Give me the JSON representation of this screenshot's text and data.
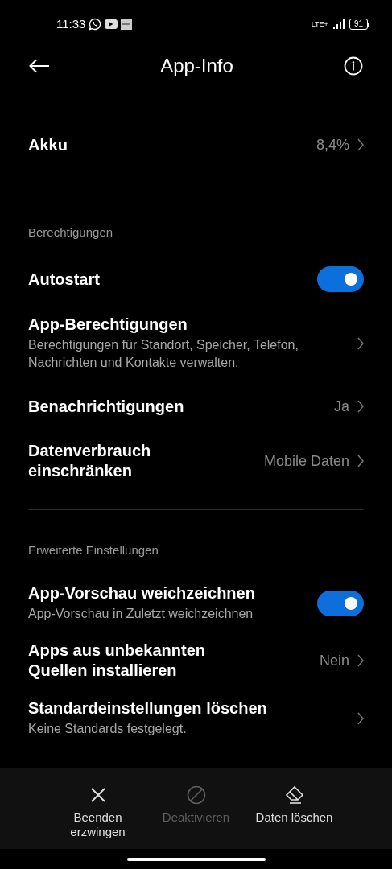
{
  "status_bar": {
    "time": "11:33",
    "network": "LTE+",
    "battery": "91"
  },
  "header": {
    "title": "App-Info"
  },
  "top_items": [
    {
      "kind": "value",
      "title": "Akku",
      "value": "8,4%"
    }
  ],
  "sections": [
    {
      "title": "Berechtigungen",
      "items": [
        {
          "kind": "toggle",
          "title": "Autostart",
          "on": true
        },
        {
          "kind": "value",
          "title": "App-Berechtigungen",
          "subtitle": "Berechtigungen für Standort, Speicher, Telefon, Nachrichten und Kontakte verwalten."
        },
        {
          "kind": "value",
          "title": "Benachrichtigungen",
          "value": "Ja"
        },
        {
          "kind": "value",
          "title": "Datenverbrauch einschränken",
          "value": "Mobile Daten"
        }
      ]
    },
    {
      "title": "Erweiterte Einstellungen",
      "items": [
        {
          "kind": "toggle",
          "title": "App-Vorschau weichzeichnen",
          "subtitle": "App-Vorschau in Zuletzt weichzeichnen",
          "on": true
        },
        {
          "kind": "value",
          "title": "Apps aus unbekannten Quellen installieren",
          "value": "Nein"
        },
        {
          "kind": "value",
          "title": "Standardeinstellungen löschen",
          "subtitle": "Keine Standards festgelegt."
        }
      ]
    }
  ],
  "actions": [
    {
      "kind": "stop",
      "label": "Beenden erzwingen",
      "disabled": false
    },
    {
      "kind": "disable",
      "label": "Deaktivieren",
      "disabled": true
    },
    {
      "kind": "clear",
      "label": "Daten löschen",
      "disabled": false
    }
  ]
}
